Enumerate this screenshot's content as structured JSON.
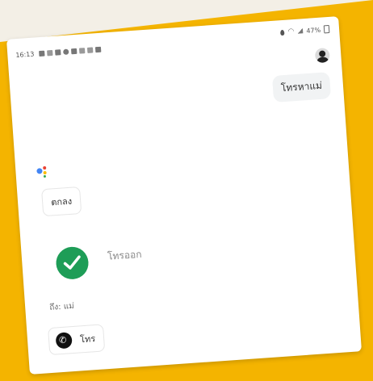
{
  "status_bar": {
    "time": "16:13",
    "battery": "47%"
  },
  "conversation": {
    "user_message": "โทรหาแม่",
    "assistant_reply": "ตกลง",
    "calling_status": "โทรออก",
    "call_to": "ถึง: แม่",
    "call_button_label": "โทร"
  },
  "colors": {
    "background_accent": "#f4b400",
    "check_green": "#1e9d57"
  },
  "icons": [
    "location-icon",
    "wifi-icon",
    "signal-icon",
    "battery-icon",
    "google-assistant-icon",
    "check-icon",
    "phone-icon",
    "avatar"
  ]
}
